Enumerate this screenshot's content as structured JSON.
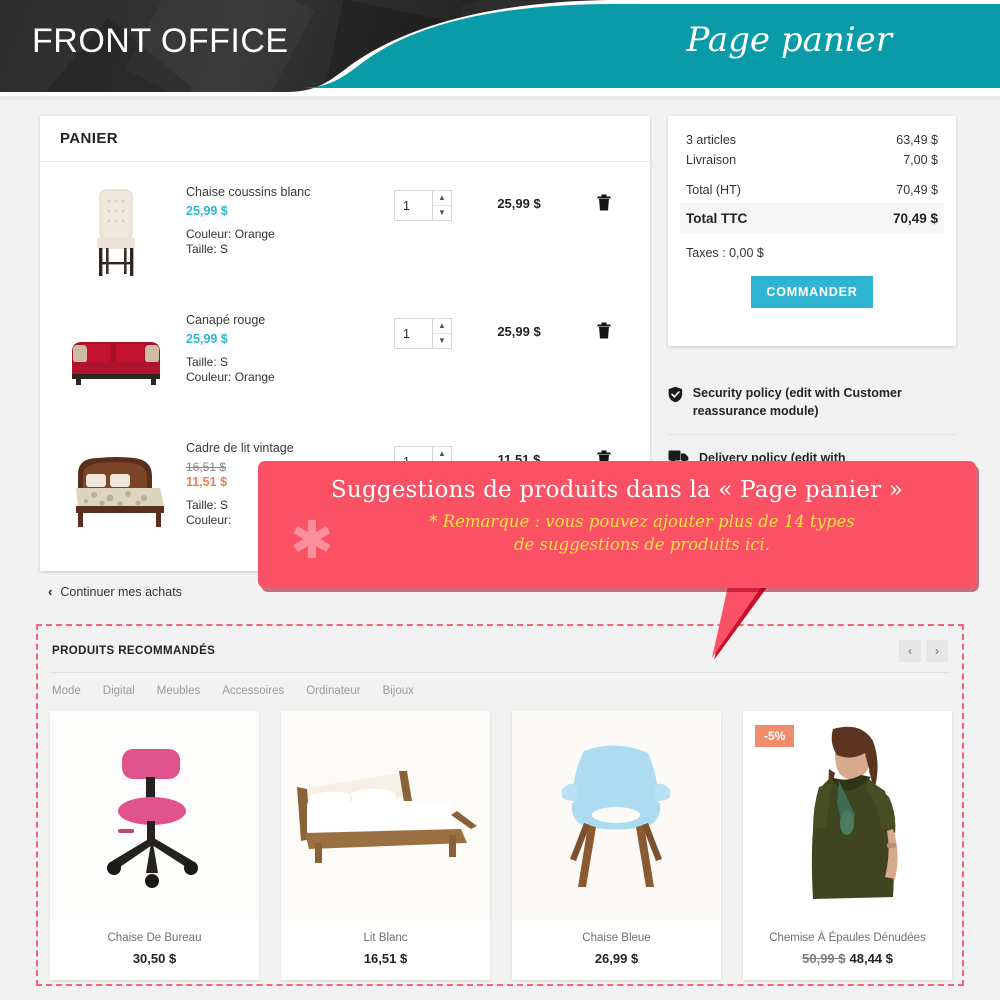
{
  "header": {
    "title": "FRONT OFFICE",
    "subtitle": "Page panier",
    "teal": "#0a9ba8",
    "dark": "#2b2b2b"
  },
  "cart": {
    "panel_title": "PANIER",
    "continue_label": "Continuer mes achats",
    "continue_icon": "chevron-left-icon",
    "rows": [
      {
        "name": "Chaise coussins blanc",
        "unit_price": "25,99 $",
        "old_price": "",
        "sale_price": "",
        "attr1": "Couleur: Orange",
        "attr2": "Taille: S",
        "qty": "1",
        "line_total": "25,99 $",
        "image": "white-tufted-chair",
        "remove_icon": "trash-icon"
      },
      {
        "name": "Canapé rouge",
        "unit_price": "25,99 $",
        "old_price": "",
        "sale_price": "",
        "attr1": "Taille: S",
        "attr2": "Couleur: Orange",
        "qty": "1",
        "line_total": "25,99 $",
        "image": "red-sofa",
        "remove_icon": "trash-icon"
      },
      {
        "name": "Cadre de lit vintage",
        "unit_price": "",
        "old_price": "16,51 $",
        "sale_price": "11,51 $",
        "attr1": "Taille: S",
        "attr2": "Couleur:",
        "qty": "1",
        "line_total": "11,51 $",
        "image": "vintage-bed-frame",
        "remove_icon": "trash-icon"
      }
    ]
  },
  "summary": {
    "articles_label": "3 articles",
    "articles_value": "63,49 $",
    "shipping_label": "Livraison",
    "shipping_value": "7,00 $",
    "total_ht_label": "Total (HT)",
    "total_ht_value": "70,49 $",
    "total_ttc_label": "Total TTC",
    "total_ttc_value": "70,49 $",
    "taxes_label": "Taxes : 0,00 $",
    "order_button": "COMMANDER",
    "accent": "#2fb5d2"
  },
  "reassurance": {
    "items": [
      {
        "icon": "shield-check-icon",
        "text": "Security policy (edit with Customer reassurance module)"
      },
      {
        "icon": "truck-icon",
        "text": "Delivery policy (edit with"
      }
    ]
  },
  "recommended": {
    "title": "PRODUITS RECOMMANDÉS",
    "prev_icon": "chevron-left-icon",
    "next_icon": "chevron-right-icon",
    "tabs": [
      "Mode",
      "Digital",
      "Meubles",
      "Accessoires",
      "Ordinateur",
      "Bijoux"
    ],
    "products": [
      {
        "name": "Chaise De Bureau",
        "price": "30,50 $",
        "old_price": "",
        "badge": "",
        "image": "pink-office-chair"
      },
      {
        "name": "Lit Blanc",
        "price": "16,51 $",
        "old_price": "",
        "badge": "",
        "image": "white-bed"
      },
      {
        "name": "Chaise Bleue",
        "price": "26,99 $",
        "old_price": "",
        "badge": "",
        "image": "blue-chair"
      },
      {
        "name": "Chemise À Épaules Dénudées",
        "price": "48,44 $",
        "old_price": "50,99 $",
        "badge": "-5%",
        "image": "olive-dress"
      }
    ],
    "border_color": "#f4637a",
    "badge_color": "#ee8d6b"
  },
  "callout": {
    "title": "Suggestions de produits dans la « Page panier »",
    "note_line1": "* Remarque : vous pouvez ajouter plus de 14 types",
    "note_line2": "de suggestions de produits ici.",
    "asterisk_icon": "asterisk-icon",
    "bg": "#fb5164",
    "note_color": "#ffe04b"
  }
}
